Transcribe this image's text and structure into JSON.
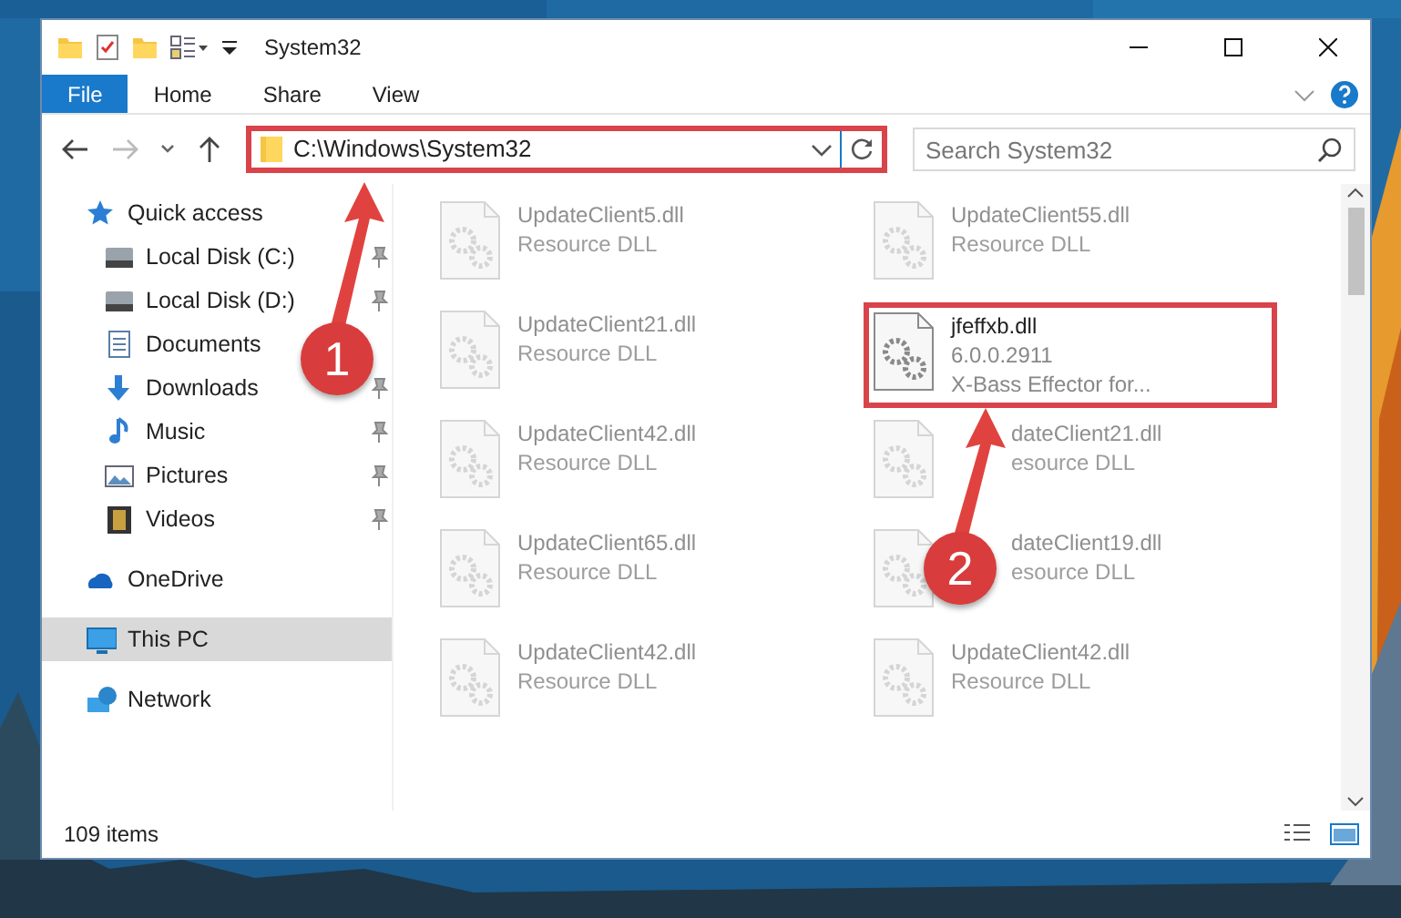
{
  "window": {
    "title": "System32"
  },
  "ribbon": {
    "tabs": [
      {
        "label": "File",
        "kind": "file",
        "selected": false
      },
      {
        "label": "Home",
        "kind": "tab",
        "selected": false
      },
      {
        "label": "Share",
        "kind": "tab",
        "selected": false
      },
      {
        "label": "View",
        "kind": "tab",
        "selected": false
      }
    ]
  },
  "address": {
    "path": "C:\\Windows\\System32",
    "highlighted": true
  },
  "search": {
    "placeholder": "Search System32"
  },
  "nav": [
    {
      "label": "Quick access",
      "kind": "star",
      "selected": false,
      "children": [
        {
          "label": "Local Disk (C:)",
          "kind": "drive",
          "pinned": true,
          "selected": false
        },
        {
          "label": "Local Disk (D:)",
          "kind": "drive",
          "pinned": true,
          "selected": false
        },
        {
          "label": "Documents",
          "kind": "documents",
          "pinned": false,
          "selected": false
        },
        {
          "label": "Downloads",
          "kind": "downloads",
          "pinned": true,
          "selected": false
        },
        {
          "label": "Music",
          "kind": "music",
          "pinned": true,
          "selected": false
        },
        {
          "label": "Pictures",
          "kind": "pictures",
          "pinned": true,
          "selected": false
        },
        {
          "label": "Videos",
          "kind": "videos",
          "pinned": true,
          "selected": false
        }
      ]
    },
    {
      "label": "OneDrive",
      "kind": "cloud",
      "selected": false
    },
    {
      "label": "This PC",
      "kind": "computer",
      "selected": true
    },
    {
      "label": "Network",
      "kind": "network",
      "selected": false
    }
  ],
  "files": [
    {
      "name": "UpdateClient5.dll",
      "line_2": "Resource DLL",
      "dimmed": true,
      "highlighted": false
    },
    {
      "name": "UpdateClient55.dll",
      "line_2": "Resource DLL",
      "dimmed": true,
      "highlighted": false
    },
    {
      "name": "UpdateClient21.dll",
      "line_2": "Resource DLL",
      "dimmed": true,
      "highlighted": false
    },
    {
      "name": "jfeffxb.dll",
      "line_2": "6.0.0.2911",
      "line_3": "X-Bass Effector for...",
      "dimmed": false,
      "highlighted": true
    },
    {
      "name": "UpdateClient42.dll",
      "line_2": "Resource DLL",
      "dimmed": true,
      "highlighted": false
    },
    {
      "name": "dateClient21.dll",
      "line_2": "esource DLL",
      "dimmed": true,
      "highlighted": false
    },
    {
      "name": "UpdateClient65.dll",
      "line_2": "Resource DLL",
      "dimmed": true,
      "highlighted": false
    },
    {
      "name": "dateClient19.dll",
      "line_2": "esource DLL",
      "dimmed": true,
      "highlighted": false
    },
    {
      "name": "UpdateClient42.dll",
      "line_2": "Resource DLL",
      "dimmed": true,
      "highlighted": false
    },
    {
      "name": "UpdateClient42.dll",
      "line_2": "Resource DLL",
      "dimmed": true,
      "highlighted": false
    }
  ],
  "status_bar": {
    "count": "109 items"
  },
  "annotations": [
    {
      "number": "1"
    },
    {
      "number": "2"
    }
  ]
}
